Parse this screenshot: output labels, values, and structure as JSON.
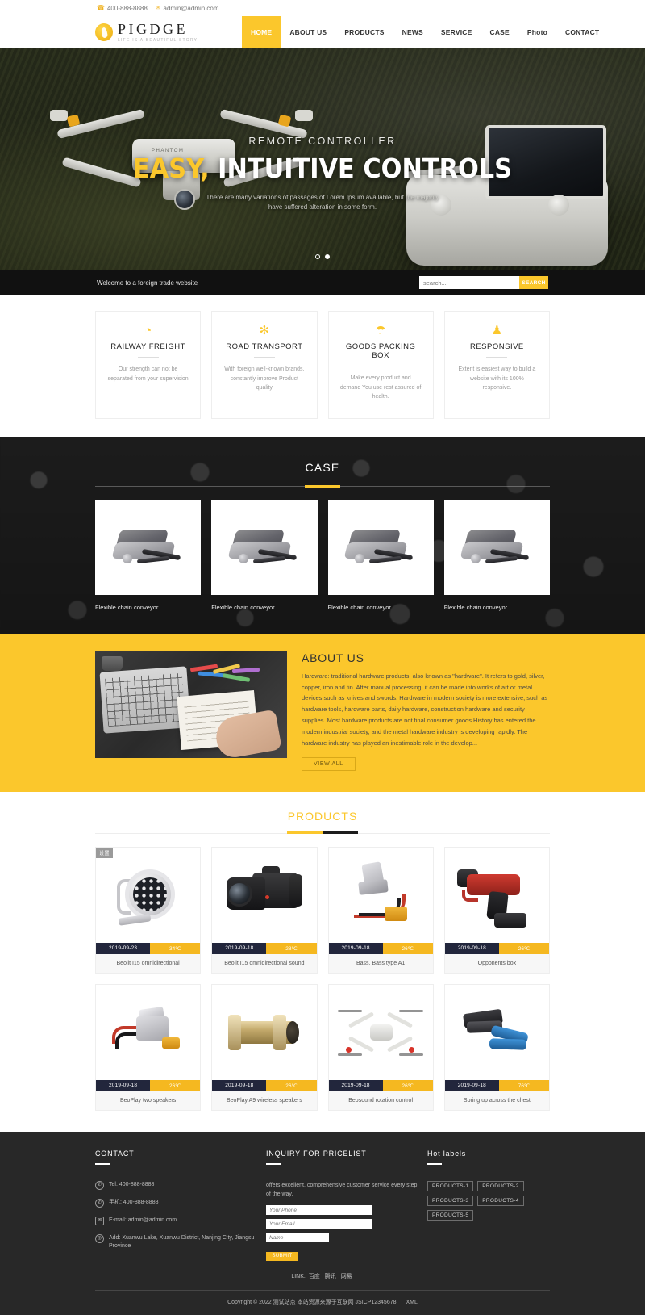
{
  "topbar": {
    "phone_icon": "phone-icon",
    "phone": "400-888-8888",
    "mail_icon": "mail-icon",
    "email": "admin@admin.com"
  },
  "header": {
    "logo_name": "PIGDGE",
    "logo_tagline": "LIFE IS A BEAUTIFUL STORY",
    "nav": [
      {
        "label": "HOME",
        "active": true
      },
      {
        "label": "ABOUT US",
        "active": false
      },
      {
        "label": "PRODUCTS",
        "active": false
      },
      {
        "label": "NEWS",
        "active": false
      },
      {
        "label": "SERVICE",
        "active": false
      },
      {
        "label": "CASE",
        "active": false
      },
      {
        "label": "Photo",
        "active": false
      },
      {
        "label": "CONTACT",
        "active": false
      }
    ]
  },
  "hero": {
    "kicker": "REMOTE CONTROLLER",
    "title_highlight": "EASY,",
    "title_rest": " INTUITIVE CONTROLS",
    "subtitle_line1": "There are many variations of passages of Lorem Ipsum available, but the majority",
    "subtitle_line2": "have suffered alteration in some form.",
    "drone_label": "PHANTOM",
    "slides": 2,
    "active_slide": 2
  },
  "welcome": {
    "text": "Welcome to a foreign trade website",
    "search_placeholder": "search...",
    "search_button": "SEARCH"
  },
  "features": [
    {
      "icon": "train-icon",
      "glyph": "◔",
      "title": "RAILWAY FREIGHT",
      "desc": "Our strength can not be separated from your supervision"
    },
    {
      "icon": "gear-icon",
      "glyph": "✻",
      "title": "ROAD TRANSPORT",
      "desc": "With foreign well-known brands, constantly improve Product quality"
    },
    {
      "icon": "umbrella-icon",
      "glyph": "☂",
      "title": "GOODS PACKING BOX",
      "desc": "Make every product and demand You use rest assured of health."
    },
    {
      "icon": "user-icon",
      "glyph": "♟",
      "title": "RESPONSIVE",
      "desc": "Extent is easiest way to build a website with its 100% responsive."
    }
  ],
  "case": {
    "title": "CASE",
    "items": [
      {
        "caption": "Flexible chain conveyor"
      },
      {
        "caption": "Flexible chain conveyor"
      },
      {
        "caption": "Flexible chain conveyor"
      },
      {
        "caption": "Flexible chain conveyor"
      }
    ]
  },
  "about": {
    "title": "ABOUT US",
    "text": "Hardware: traditional hardware products, also known as \"hardware\". It refers to gold, silver, copper, iron and tin. After manual processing, it can be made into works of art or metal devices such as knives and swords. Hardware in modern society is more extensive, such as hardware tools, hardware parts, daily hardware, construction hardware and security supplies. Most hardware products are not final consumer goods.History has entered the modern industrial society, and the metal hardware industry is developing rapidly. The hardware industry has played an inestimable role in the develop...",
    "button": "VIEW ALL"
  },
  "products": {
    "title": "PRODUCTS",
    "items": [
      {
        "badge": "设置",
        "date": "2019-09-23",
        "temp": "34℃",
        "name": "Beolit I15 omnidirectional",
        "art": "pi-flood"
      },
      {
        "badge": "",
        "date": "2019-09-18",
        "temp": "28℃",
        "name": "Beolit I15 omnidirectional sound",
        "art": "pi-cam"
      },
      {
        "badge": "",
        "date": "2019-09-18",
        "temp": "26℃",
        "name": "Bass, Bass type A1",
        "art": "pi-conn"
      },
      {
        "badge": "",
        "date": "2019-09-18",
        "temp": "26℃",
        "name": "Opponents box",
        "art": "pi-tool"
      },
      {
        "badge": "",
        "date": "2019-09-18",
        "temp": "26℃",
        "name": "BeoPlay two speakers",
        "art": "pi-wire"
      },
      {
        "badge": "",
        "date": "2019-09-18",
        "temp": "26℃",
        "name": "BeoPlay A9 wireless speakers",
        "art": "pi-brass"
      },
      {
        "badge": "",
        "date": "2019-09-18",
        "temp": "26℃",
        "name": "Beosound rotation control",
        "art": "pi-drone"
      },
      {
        "badge": "",
        "date": "2019-09-18",
        "temp": "76℃",
        "name": "Spring up across the chest",
        "art": "pi-crimp"
      }
    ]
  },
  "footer": {
    "contact": {
      "head": "CONTACT",
      "items": [
        {
          "icon": "phone-icon",
          "glyph": "✆",
          "text": "Tel:  400-888-8888"
        },
        {
          "icon": "whatsapp-icon",
          "glyph": "✆",
          "text": "手机:  400-888-8888"
        },
        {
          "icon": "envelope-icon",
          "glyph": "✉",
          "text": "E-mail: admin@admin.com"
        },
        {
          "icon": "location-icon",
          "glyph": "◎",
          "text": "Add:  Xuanwu Lake, Xuanwu District, Nanjing City, Jiangsu Province"
        }
      ]
    },
    "inquiry": {
      "head": "INQUIRY FOR PRICELIST",
      "blurb": "offers excellent, comprehensive customer service every step of the way.",
      "phone_placeholder": "Your Phone",
      "email_placeholder": "Your Email",
      "name_placeholder": "Name",
      "submit": "SUBMIT"
    },
    "hot": {
      "head": "Hot labels",
      "tags": [
        "PRODUCTS-1",
        "PRODUCTS-2",
        "PRODUCTS-3",
        "PRODUCTS-4",
        "PRODUCTS-5"
      ]
    },
    "link_label": "LINK:",
    "links": [
      "百度",
      "腾讯",
      "网易"
    ],
    "copyright": "Copyright © 2022 测试站点 本站资源来源于互联网 JSICP12345678",
    "xml": "XML"
  },
  "colors": {
    "accent": "#fbc72c",
    "accent_dark": "#f5b820",
    "dark": "#282828",
    "case_bg": "#171717",
    "date_badge": "#22263c"
  }
}
